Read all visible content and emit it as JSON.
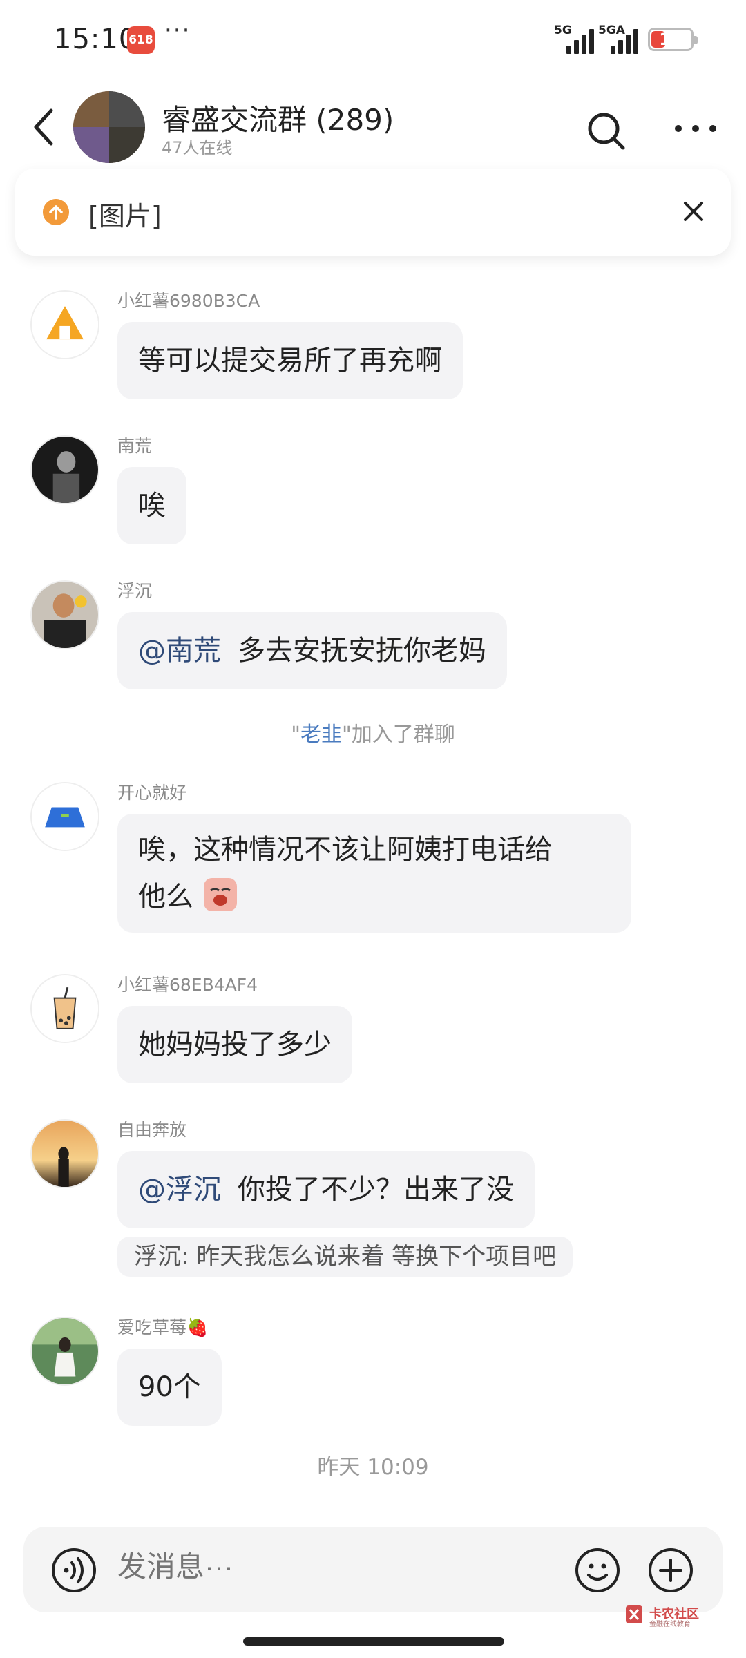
{
  "status": {
    "time": "15:10",
    "app_badge": "618",
    "more": "···",
    "signal1": "5G",
    "signal2": "5GA",
    "battery": "17"
  },
  "header": {
    "title": "睿盛交流群 (289)",
    "subtitle": "47人在线"
  },
  "pinned": {
    "text": "[图片]"
  },
  "messages": [
    {
      "sender": "小红薯6980B3CA",
      "text": "等可以提交易所了再充啊"
    },
    {
      "sender": "南荒",
      "text": "唉"
    },
    {
      "sender": "浮沉",
      "mention": "@南荒",
      "text": "多去安抚安抚你老妈"
    },
    {
      "sender": "开心就好",
      "line1": "唉，这种情况不该让阿姨打电话给",
      "line2": "他么"
    },
    {
      "sender": "小红薯68EB4AF4",
      "text": "她妈妈投了多少"
    },
    {
      "sender": "自由奔放",
      "mention": "@浮沉",
      "text": "你投了不少？出来了没",
      "quote": "浮沉: 昨天我怎么说来着  等换下个项目吧"
    },
    {
      "sender": "爱吃草莓🍓",
      "text": "90个"
    }
  ],
  "system": {
    "quote_open": "\"",
    "name": "老韭",
    "quote_close": "\"",
    "action": "加入了群聊"
  },
  "timestamp": "昨天 10:09",
  "composer": {
    "placeholder": "发消息···"
  },
  "watermark": {
    "name": "卡农社区",
    "sub": "金融在线教育"
  }
}
